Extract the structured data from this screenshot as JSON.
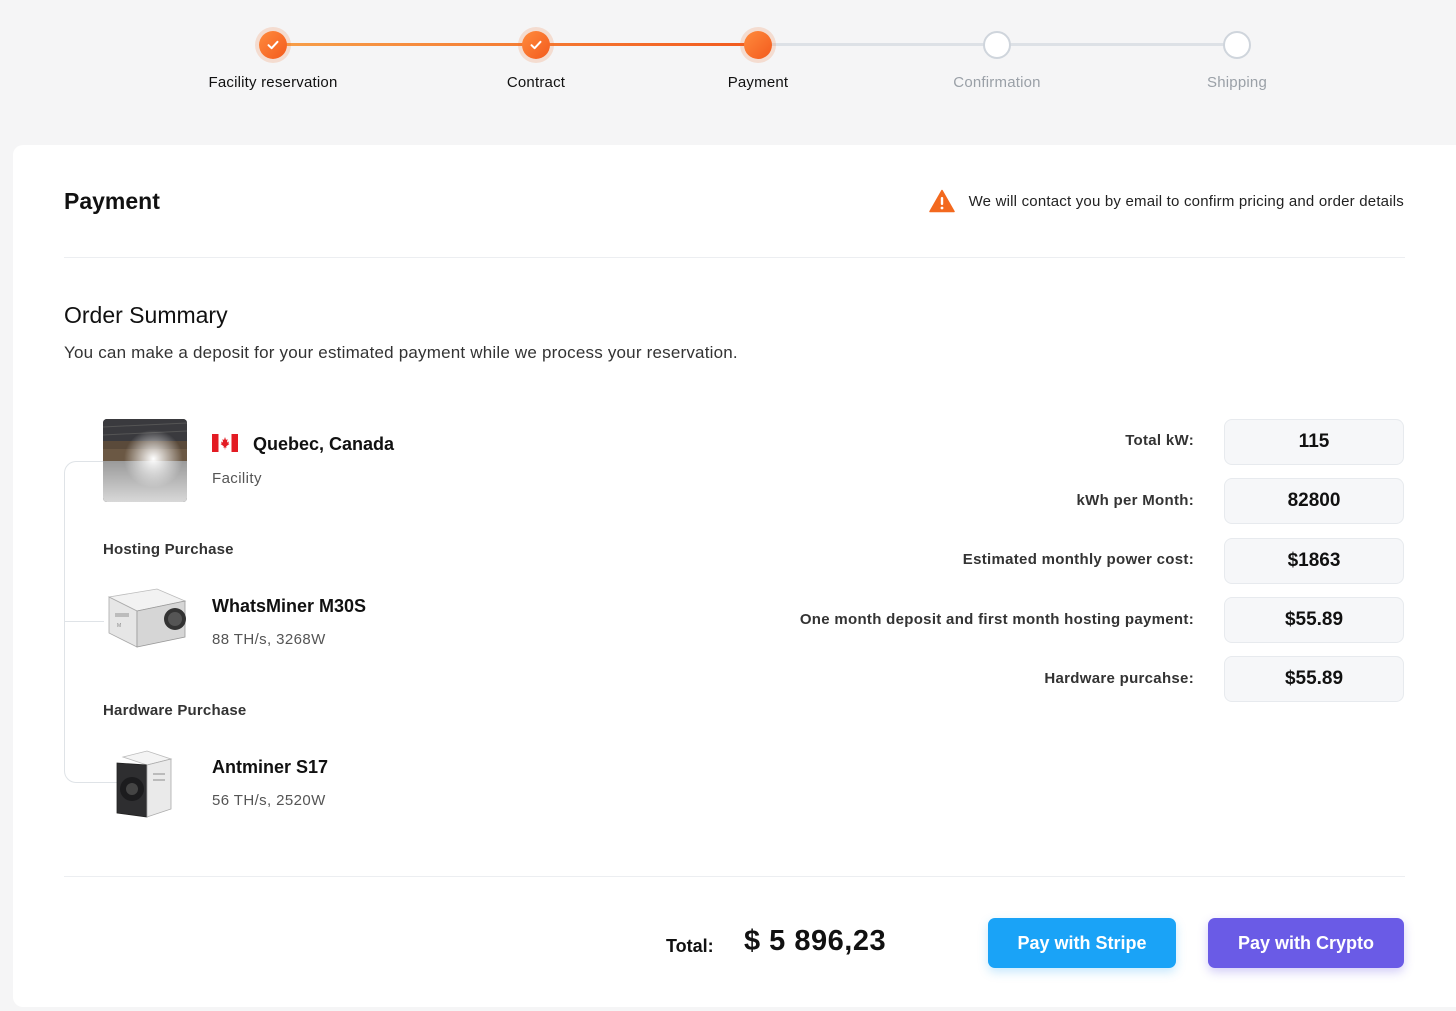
{
  "stepper": {
    "steps": [
      {
        "label": "Facility reservation",
        "state": "done"
      },
      {
        "label": "Contract",
        "state": "done"
      },
      {
        "label": "Payment",
        "state": "current"
      },
      {
        "label": "Confirmation",
        "state": "todo"
      },
      {
        "label": "Shipping",
        "state": "todo"
      }
    ]
  },
  "header": {
    "title": "Payment",
    "notice": "We will contact you by email to confirm pricing and order details",
    "notice_icon": "warning-icon"
  },
  "summary": {
    "title": "Order Summary",
    "description": "You can make a deposit for your estimated payment while we process your reservation."
  },
  "facility": {
    "name": "Quebec, Canada",
    "type": "Facility",
    "flag": "canada-flag"
  },
  "hosting": {
    "group_label": "Hosting Purchase",
    "name": "WhatsMiner M30S",
    "specs": "88 TH/s, 3268W"
  },
  "hardware": {
    "group_label": "Hardware Purchase",
    "name": "Antminer S17",
    "specs": "56 TH/s, 2520W"
  },
  "metrics": [
    {
      "label": "Total kW:",
      "value": "115"
    },
    {
      "label": "kWh per Month:",
      "value": "82800"
    },
    {
      "label": "Estimated monthly power cost:",
      "value": "$1863"
    },
    {
      "label": "One month deposit and first month hosting payment:",
      "value": "$55.89"
    },
    {
      "label": "Hardware purcahse:",
      "value": "$55.89"
    }
  ],
  "footer": {
    "total_label": "Total:",
    "total_value": "$ 5 896,23",
    "stripe_label": "Pay with Stripe",
    "crypto_label": "Pay with Crypto"
  },
  "colors": {
    "accent": "#f35a1d",
    "stripe": "#1aa3f7",
    "crypto": "#6a5be6"
  }
}
